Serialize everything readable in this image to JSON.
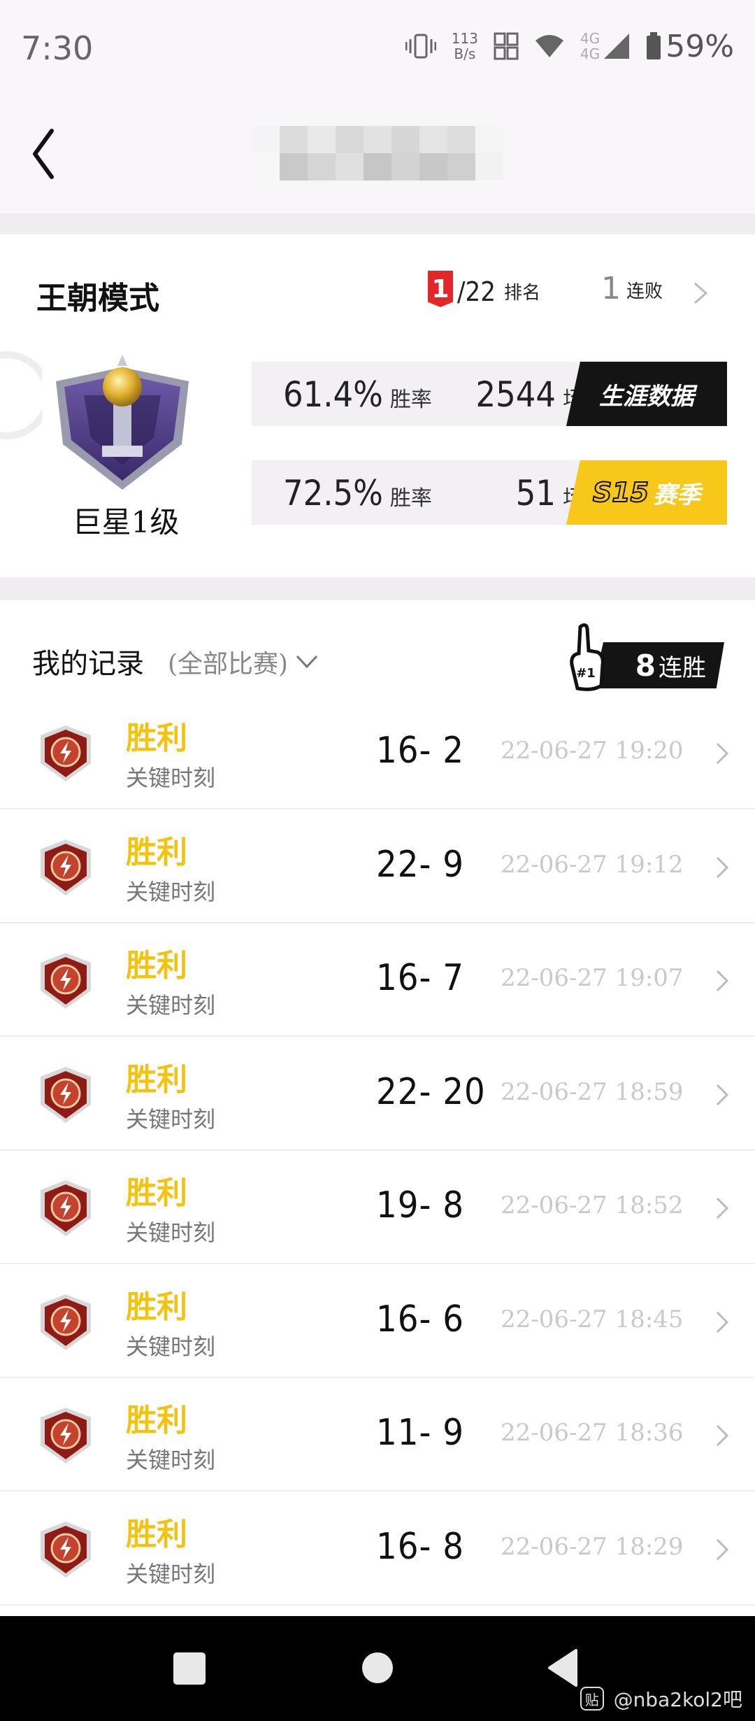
{
  "status_bar": {
    "time": "7:30",
    "net_speed_value": "113",
    "net_speed_unit": "B/s",
    "signal_label_top": "4G",
    "signal_label_bottom": "4G",
    "battery": "59%"
  },
  "header": {
    "back_icon": "chevron-left-icon",
    "title_obscured": true
  },
  "summary": {
    "mode_title": "王朝模式",
    "rank": "1",
    "rank_total": "/22",
    "rank_label": "排名",
    "streak_value": "1",
    "streak_label": "连败",
    "rank_name": "巨星1级",
    "career": {
      "win_rate": "61.4%",
      "win_rate_label": "胜率",
      "games": "2544",
      "games_label": "场",
      "tag": "生涯数据"
    },
    "season": {
      "win_rate": "72.5%",
      "win_rate_label": "胜率",
      "games": "51",
      "games_label": "场",
      "tag_code": "S15",
      "tag": "赛季"
    }
  },
  "records": {
    "title": "我的记录",
    "filter": "(全部比赛)",
    "win_streak_badge_rank": "#1",
    "win_streak_value": "8",
    "win_streak_label": "连胜",
    "items": [
      {
        "result": "胜利",
        "mode": "关键时刻",
        "score": "16- 2",
        "date": "22-06-27 19:20"
      },
      {
        "result": "胜利",
        "mode": "关键时刻",
        "score": "22- 9",
        "date": "22-06-27 19:12"
      },
      {
        "result": "胜利",
        "mode": "关键时刻",
        "score": "16- 7",
        "date": "22-06-27 19:07"
      },
      {
        "result": "胜利",
        "mode": "关键时刻",
        "score": "22- 20",
        "date": "22-06-27 18:59"
      },
      {
        "result": "胜利",
        "mode": "关键时刻",
        "score": "19- 8",
        "date": "22-06-27 18:52"
      },
      {
        "result": "胜利",
        "mode": "关键时刻",
        "score": "16- 6",
        "date": "22-06-27 18:45"
      },
      {
        "result": "胜利",
        "mode": "关键时刻",
        "score": "11- 9",
        "date": "22-06-27 18:36"
      },
      {
        "result": "胜利",
        "mode": "关键时刻",
        "score": "16- 8",
        "date": "22-06-27 18:29"
      }
    ]
  },
  "nav": {
    "recent_icon": "square-icon",
    "home_icon": "circle-icon",
    "back_icon": "triangle-back-icon"
  },
  "watermark": {
    "logo": "贴",
    "text": "@nba2kol2吧"
  },
  "colors": {
    "win": "#f2c40f",
    "rank_badge": "#e02828",
    "season_tag": "#f7c81a",
    "career_tag": "#141414"
  }
}
